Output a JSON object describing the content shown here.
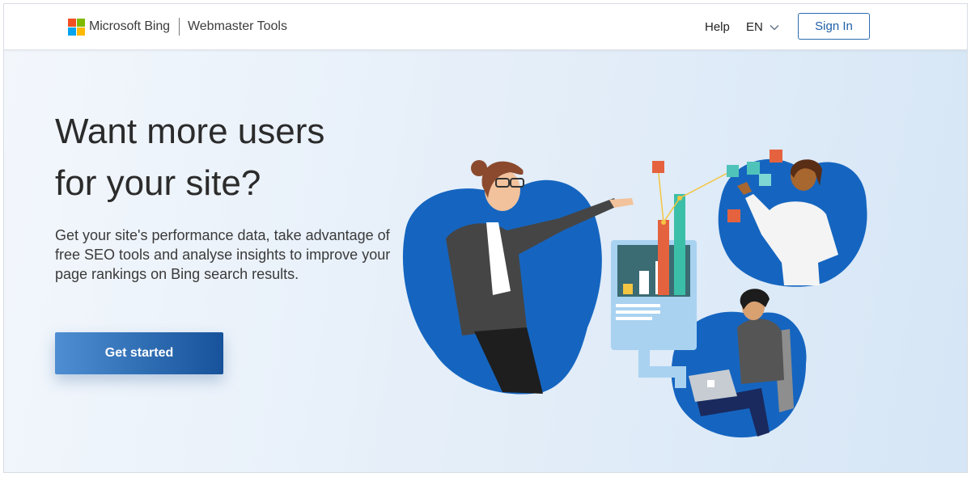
{
  "header": {
    "brand_name": "Microsoft Bing",
    "product_name": "Webmaster Tools",
    "help_label": "Help",
    "language_label": "EN",
    "signin_label": "Sign In"
  },
  "hero": {
    "title_line1": "Want more users",
    "title_line2": "for your site?",
    "description": "Get your site's performance data, take advantage of free SEO tools and analyse insights to improve your page rankings on Bing search results.",
    "cta_label": "Get started"
  },
  "colors": {
    "logo_red": "#f25022",
    "logo_green": "#7fba00",
    "logo_blue": "#00a4ef",
    "logo_yellow": "#ffb900",
    "accent_blue": "#1f5fa8",
    "illustration_blue": "#1565c0"
  },
  "icons": {
    "brand": "microsoft-logo-icon",
    "language": "chevron-down-icon"
  }
}
